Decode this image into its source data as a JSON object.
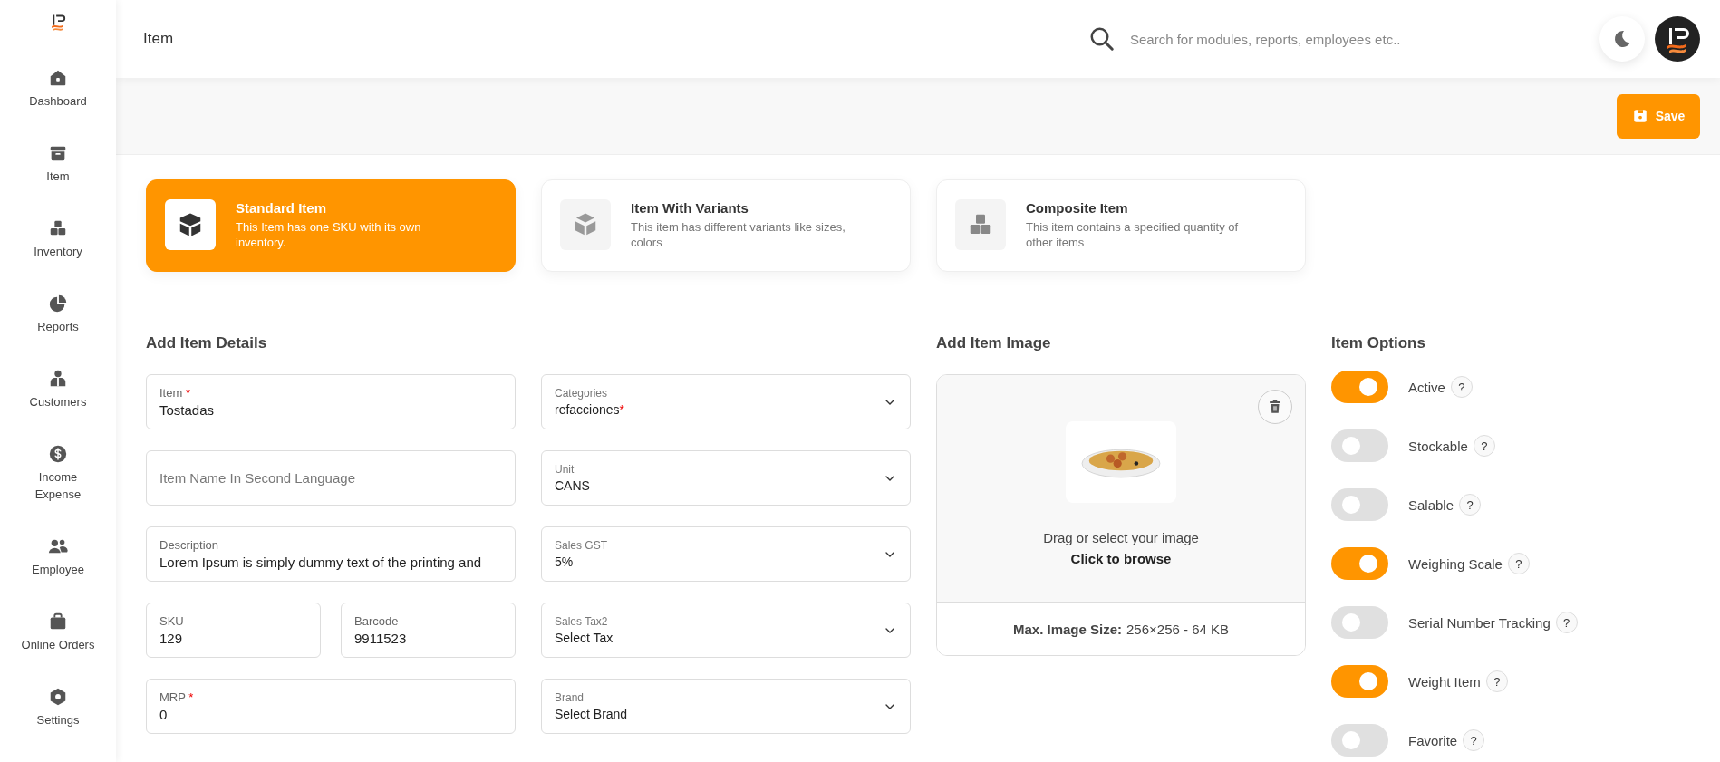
{
  "sidebar": {
    "items": [
      {
        "label": "Dashboard"
      },
      {
        "label": "Item"
      },
      {
        "label": "Inventory"
      },
      {
        "label": "Reports"
      },
      {
        "label": "Customers"
      },
      {
        "label": "Income Expense"
      },
      {
        "label": "Employee"
      },
      {
        "label": "Online Orders"
      },
      {
        "label": "Settings"
      }
    ]
  },
  "header": {
    "title": "Item",
    "search": {
      "placeholder": "Search for modules, reports, employees etc.."
    }
  },
  "toolbar": {
    "save_button": "Save"
  },
  "item_types": [
    {
      "title": "Standard Item",
      "description": "This Item has one SKU with its own inventory.",
      "selected": true
    },
    {
      "title": "Item With Variants",
      "description": "This item has different variants like sizes, colors",
      "selected": false
    },
    {
      "title": "Composite Item",
      "description": "This item contains a specified quantity of other items",
      "selected": false
    }
  ],
  "details": {
    "title": "Add Item Details",
    "left_fields": [
      {
        "kind": "text",
        "label": "Item",
        "mark": "*",
        "value": "Tostadas"
      },
      {
        "kind": "placeholder",
        "placeholder": "Item Name In Second Language"
      },
      {
        "kind": "text",
        "label": "Description",
        "value": "Lorem Ipsum is simply dummy text of the printing and"
      },
      {
        "kind": "pair",
        "fields": [
          {
            "label": "SKU",
            "value": "129"
          },
          {
            "label": "Barcode",
            "value": "9911523"
          }
        ]
      },
      {
        "kind": "text",
        "label": "MRP",
        "mark": "*",
        "value": "0"
      }
    ],
    "right_fields": [
      {
        "label": "Categories",
        "value": "refacciones",
        "mark": "*"
      },
      {
        "label": "Unit",
        "value": "CANS"
      },
      {
        "label": "Sales GST",
        "value": "5%"
      },
      {
        "label": "Sales Tax2",
        "value": "Select Tax"
      },
      {
        "label": "Brand",
        "value": "Select Brand"
      }
    ]
  },
  "image": {
    "title": "Add Item Image",
    "hint": "Drag or select your image",
    "browse": "Click to browse",
    "size_label": "Max. Image Size:",
    "size_value": "256×256 - 64 KB"
  },
  "options": {
    "title": "Item Options",
    "items": [
      {
        "label": "Active",
        "on": true,
        "help": "?"
      },
      {
        "label": "Stockable",
        "on": false,
        "help": "?"
      },
      {
        "label": "Salable",
        "on": false,
        "help": "?"
      },
      {
        "label": "Weighing Scale",
        "on": true,
        "help": "?"
      },
      {
        "label": "Serial Number Tracking",
        "on": false,
        "help": "?"
      },
      {
        "label": "Weight Item",
        "on": true,
        "help": "?"
      },
      {
        "label": "Favorite",
        "on": false,
        "help": "?"
      }
    ]
  }
}
